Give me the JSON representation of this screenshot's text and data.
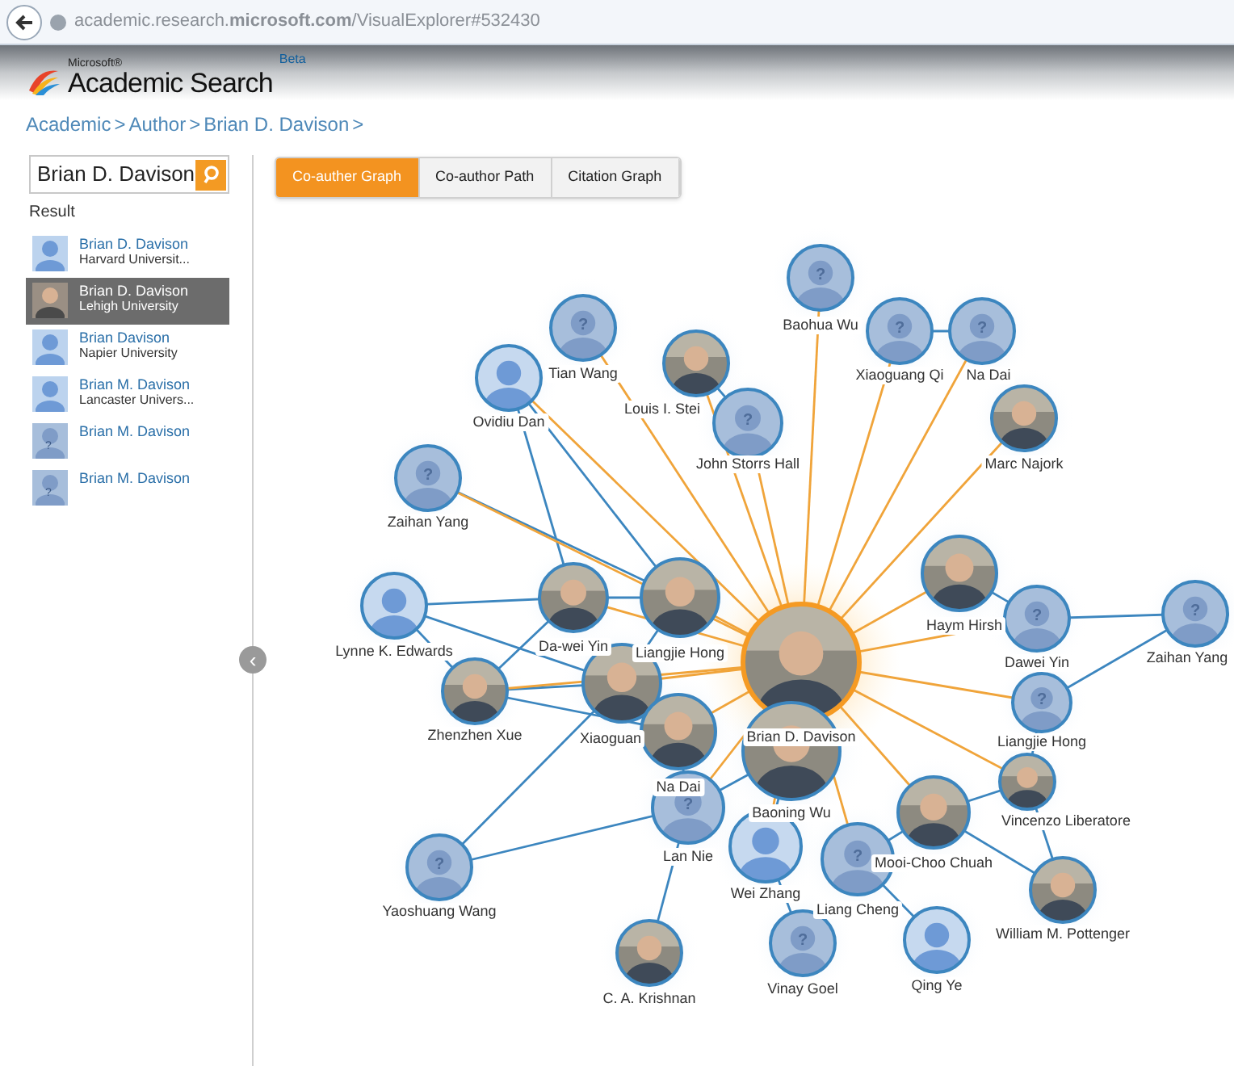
{
  "browser": {
    "url": "academic.research.**microsoft.com**/VisualExplorer#532430"
  },
  "header": {
    "brand_small": "Microsoft®",
    "brand": "Academic Search",
    "badge": "Beta"
  },
  "breadcrumb": [
    {
      "label": "Academic"
    },
    {
      "label": "Author"
    },
    {
      "label": "Brian D. Davison"
    }
  ],
  "breadcrumb_separator": ">",
  "search": {
    "value": "Brian D. Davison"
  },
  "result_heading": "Result",
  "results": [
    {
      "name": "Brian D. Davison",
      "affiliation": "Harvard Universit...",
      "kind": "silhouette",
      "selected": false
    },
    {
      "name": "Brian D. Davison",
      "affiliation": "Lehigh University",
      "selected": true
    },
    {
      "name": "Brian Davison",
      "affiliation": "Napier University",
      "kind": "silhouette",
      "selected": false
    },
    {
      "name": "Brian M. Davison",
      "affiliation": "Lancaster Univers...",
      "kind": "silhouette",
      "selected": false
    },
    {
      "name": "Brian M. Davison",
      "kind": "unknown",
      "glyph": "?",
      "selected": false
    },
    {
      "name": "Brian M. Davison",
      "kind": "unknown",
      "glyph": "?",
      "selected": false
    }
  ],
  "collapse_button": "‹",
  "tabs": [
    {
      "label": "Co-auther Graph",
      "selected": true
    },
    {
      "label": "Co-author Path",
      "selected": false
    },
    {
      "label": "Citation Graph",
      "selected": false
    }
  ],
  "graph": {
    "nodes": [
      {
        "name": "Baohua Wu",
        "kind": "unknown",
        "glyph": "?",
        "focused": false
      },
      {
        "name": "Tian Wang",
        "kind": "unknown",
        "glyph": "?",
        "focused": false
      },
      {
        "name": "Xiaoguang Qi",
        "kind": "unknown",
        "glyph": "?",
        "focused": false
      },
      {
        "name": "Na Dai",
        "kind": "unknown",
        "glyph": "?",
        "focused": false
      },
      {
        "name": "Louis I. Stei",
        "focused": false
      },
      {
        "name": "Ovidiu Dan",
        "kind": "silhouette",
        "focused": false
      },
      {
        "name": "John Storrs Hall",
        "kind": "unknown",
        "glyph": "?",
        "focused": false
      },
      {
        "name": "Marc Najork",
        "focused": false
      },
      {
        "name": "Zaihan Yang",
        "kind": "unknown",
        "glyph": "?",
        "focused": false
      },
      {
        "name": "Haym Hirsh",
        "focused": false
      },
      {
        "name": "Lynne K. Edwards",
        "kind": "silhouette",
        "focused": false
      },
      {
        "name": "Da-wei Yin",
        "focused": false
      },
      {
        "name": "Liangjie Hong",
        "focused": false
      },
      {
        "name": "Dawei Yin",
        "kind": "unknown",
        "glyph": "?",
        "focused": false
      },
      {
        "name": "Zaihan Yang",
        "kind": "unknown",
        "glyph": "?",
        "focused": false
      },
      {
        "name": "Zhenzhen Xue",
        "focused": false
      },
      {
        "name": "Xiaoguan",
        "focused": false
      },
      {
        "name": "Brian D. Davison",
        "focused": true
      },
      {
        "name": "Liangjie Hong",
        "kind": "unknown",
        "glyph": "?",
        "focused": false
      },
      {
        "name": "Na Dai",
        "focused": false
      },
      {
        "name": "Baoning Wu",
        "focused": false
      },
      {
        "name": "Vincenzo Liberatore",
        "focused": false
      },
      {
        "name": "Lan Nie",
        "kind": "unknown",
        "glyph": "?",
        "focused": false
      },
      {
        "name": "Mooi-Choo Chuah",
        "focused": false
      },
      {
        "name": "Wei Zhang",
        "kind": "silhouette",
        "focused": false
      },
      {
        "name": "Yaoshuang Wang",
        "kind": "unknown",
        "glyph": "?",
        "focused": false
      },
      {
        "name": "Liang Cheng",
        "kind": "unknown",
        "glyph": "?",
        "focused": false
      },
      {
        "name": "William M. Pottenger",
        "focused": false
      },
      {
        "name": "C. A. Krishnan",
        "focused": false
      },
      {
        "name": "Vinay Goel",
        "kind": "unknown",
        "glyph": "?",
        "focused": false
      },
      {
        "name": "Qing Ye",
        "kind": "silhouette",
        "focused": false
      }
    ]
  }
}
